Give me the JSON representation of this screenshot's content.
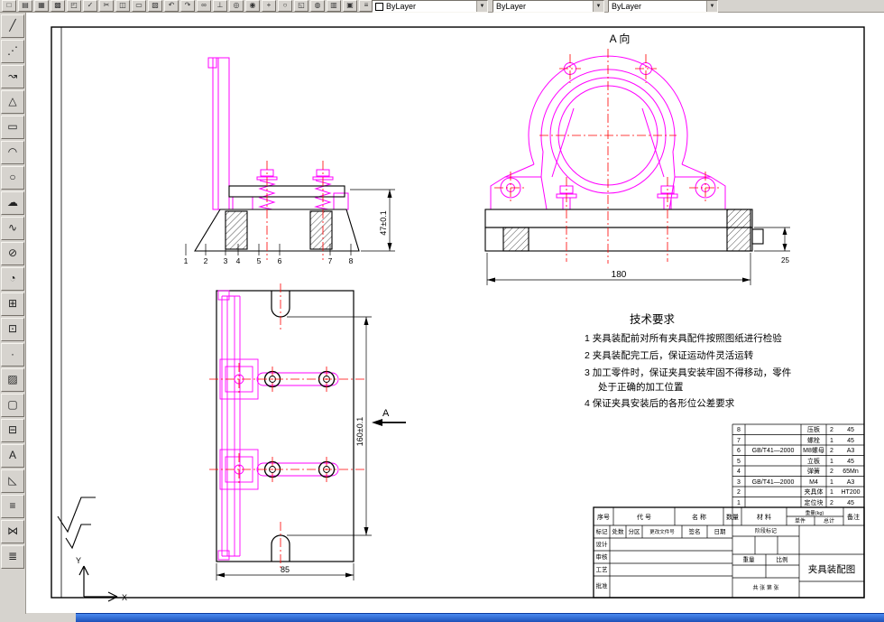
{
  "colors": {
    "chrome": "#d6d3ce",
    "canvas_white": "#ffffff",
    "geometry_magenta": "#FF00FF",
    "centerline_red": "#FF0000",
    "line_black": "#000000",
    "taskbar_blue": "#1e51b8",
    "color_chip": "#ffffff"
  },
  "toolbars": {
    "top_icons": [
      {
        "name": "new",
        "glyph": "□"
      },
      {
        "name": "open",
        "glyph": "▤"
      },
      {
        "name": "save",
        "glyph": "▦"
      },
      {
        "name": "plot",
        "glyph": "▩"
      },
      {
        "name": "plot-preview",
        "glyph": "◰"
      },
      {
        "name": "spelling",
        "glyph": "✓"
      },
      {
        "name": "cut",
        "glyph": "✂"
      },
      {
        "name": "copy",
        "glyph": "◫"
      },
      {
        "name": "paste",
        "glyph": "▭"
      },
      {
        "name": "match-properties",
        "glyph": "▧"
      },
      {
        "name": "undo",
        "glyph": "↶"
      },
      {
        "name": "redo",
        "glyph": "↷"
      },
      {
        "name": "insert-hyperlink",
        "glyph": "∞"
      },
      {
        "name": "ucs",
        "glyph": "⊥"
      },
      {
        "name": "named-views",
        "glyph": "◎"
      },
      {
        "name": "3d-orbit",
        "glyph": "◉"
      },
      {
        "name": "pan-realtime",
        "glyph": "+"
      },
      {
        "name": "zoom-realtime",
        "glyph": "○"
      },
      {
        "name": "zoom-window",
        "glyph": "◱"
      },
      {
        "name": "zoom-previous",
        "glyph": "◍"
      },
      {
        "name": "properties",
        "glyph": "▥"
      },
      {
        "name": "designcenter",
        "glyph": "▣"
      },
      {
        "name": "layers",
        "glyph": "≡"
      },
      {
        "name": "layer-previous",
        "glyph": "◨"
      },
      {
        "name": "help",
        "glyph": "?"
      }
    ],
    "left_icons": [
      {
        "name": "line",
        "glyph": "╱"
      },
      {
        "name": "construction-line",
        "glyph": "⋰"
      },
      {
        "name": "polyline",
        "glyph": "↝"
      },
      {
        "name": "polygon",
        "glyph": "△"
      },
      {
        "name": "rectangle",
        "glyph": "▭"
      },
      {
        "name": "arc",
        "glyph": "◠"
      },
      {
        "name": "circle",
        "glyph": "○"
      },
      {
        "name": "revision-cloud",
        "glyph": "☁"
      },
      {
        "name": "spline",
        "glyph": "∿"
      },
      {
        "name": "ellipse",
        "glyph": "⊘"
      },
      {
        "name": "ellipse-arc",
        "glyph": "◔"
      },
      {
        "name": "insert-block",
        "glyph": "⊞"
      },
      {
        "name": "make-block",
        "glyph": "⊡"
      },
      {
        "name": "point",
        "glyph": "·"
      },
      {
        "name": "hatch",
        "glyph": "▨"
      },
      {
        "name": "region",
        "glyph": "▢"
      },
      {
        "name": "table",
        "glyph": "⊟"
      },
      {
        "name": "multiline-text",
        "glyph": "A"
      },
      {
        "name": "erase",
        "glyph": "◺"
      },
      {
        "name": "copy-object",
        "glyph": "≡"
      },
      {
        "name": "mirror",
        "glyph": "⋈"
      },
      {
        "name": "offset",
        "glyph": "≣"
      }
    ],
    "combos": [
      {
        "name": "color",
        "value": "ByLayer"
      },
      {
        "name": "linetype",
        "value": "ByLayer"
      },
      {
        "name": "lineweight",
        "value": "ByLayer"
      }
    ]
  },
  "drawing": {
    "labels": {
      "a_view": "A 向",
      "section_a": "A",
      "ucs_x": "X",
      "ucs_y": "Y"
    },
    "dims": {
      "d180": "180",
      "d47": "47±0.1",
      "d160": "160±0.1",
      "d85": "85",
      "d25": "25"
    },
    "balloons": [
      "1",
      "2",
      "3",
      "4",
      "5",
      "6",
      "7",
      "8"
    ],
    "tech": {
      "title": "技术要求",
      "lines": [
        "1  夹具装配前对所有夹具配件按照图纸进行检验",
        "2  夹具装配完工后，保证运动件灵活运转",
        "3  加工零件时，保证夹具安装牢固不得移动，零件",
        "处于正确的加工位置",
        "4  保证夹具安装后的各形位公差要求"
      ]
    }
  },
  "bom": {
    "rows": [
      {
        "no": "8",
        "code": "",
        "name": "压板",
        "qty": "2",
        "mat": "45"
      },
      {
        "no": "7",
        "code": "",
        "name": "螺栓",
        "qty": "1",
        "mat": "45"
      },
      {
        "no": "6",
        "code": "GB/T41—2000",
        "name": "M8螺母",
        "qty": "2",
        "mat": "A3"
      },
      {
        "no": "5",
        "code": "",
        "name": "立板",
        "qty": "1",
        "mat": "45"
      },
      {
        "no": "4",
        "code": "",
        "name": "弹簧",
        "qty": "2",
        "mat": "65Mn"
      },
      {
        "no": "3",
        "code": "GB/T41—2000",
        "name": "M4",
        "qty": "1",
        "mat": "A3"
      },
      {
        "no": "2",
        "code": "",
        "name": "夹具体",
        "qty": "1",
        "mat": "HT200"
      },
      {
        "no": "1",
        "code": "",
        "name": "定位块",
        "qty": "2",
        "mat": "45"
      }
    ]
  },
  "title_block": {
    "header": {
      "no": "序号",
      "code": "代 号",
      "name": "名 称",
      "qty": "数量",
      "material": "材 料",
      "weight": "重量(kg)",
      "weight_unit": "单件",
      "weight_total": "总计",
      "note": "备注"
    },
    "rev_header": [
      "标记",
      "处数",
      "分区",
      "更改文件号",
      "签名",
      "日期"
    ],
    "roles": [
      "设计",
      "审核",
      "工艺",
      "批准"
    ],
    "stage": "阶段标记",
    "weight": "重量",
    "scale": "比例",
    "sheets": "共  张  第  张",
    "title": "夹具装配图"
  }
}
